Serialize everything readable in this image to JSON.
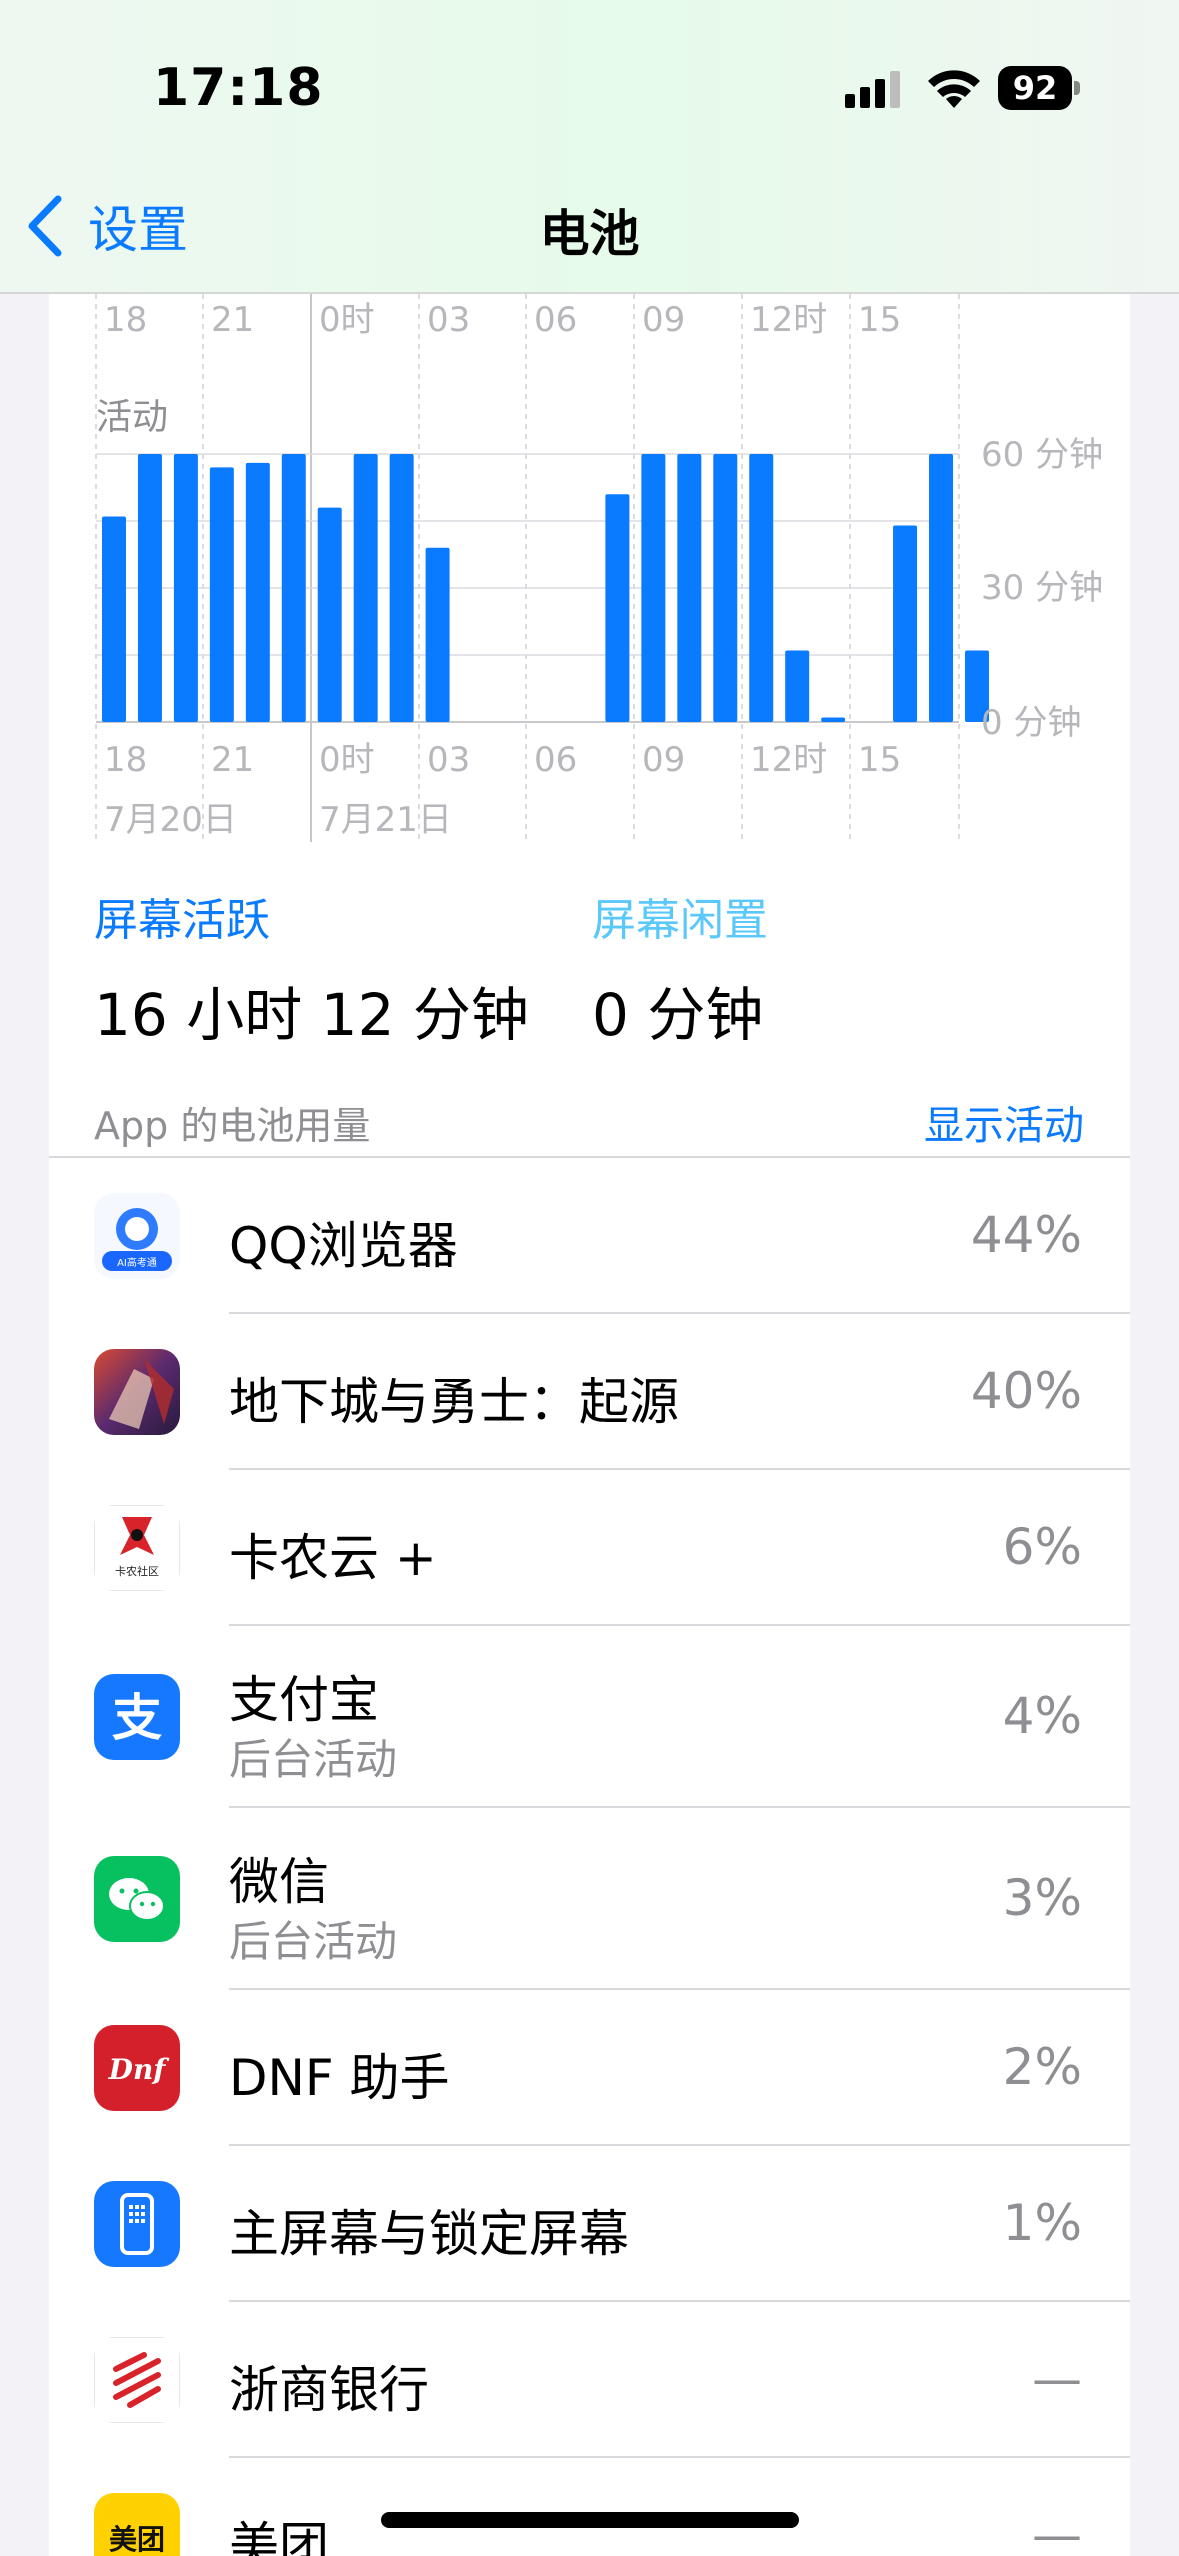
{
  "status": {
    "time": "17:18",
    "battery": "92"
  },
  "nav": {
    "back": "设置",
    "title": "电池"
  },
  "top_axis": [
    "18",
    "21",
    "0时",
    "03",
    "06",
    "09",
    "12时",
    "15"
  ],
  "chart": {
    "title": "活动"
  },
  "chart_data": {
    "type": "bar",
    "title": "活动",
    "categories": [
      "16",
      "17",
      "18",
      "19",
      "20",
      "21",
      "22",
      "23",
      "0时",
      "1",
      "2",
      "3",
      "4",
      "5",
      "6",
      "7",
      "8",
      "9",
      "10",
      "11",
      "12时",
      "13",
      "14",
      "15",
      "16",
      "17"
    ],
    "x_tick_labels": [
      "18",
      "21",
      "0时",
      "03",
      "06",
      "09",
      "12时",
      "15"
    ],
    "x_date_labels": [
      "7月20日",
      "7月21日"
    ],
    "values": [
      46,
      60,
      60,
      57,
      58,
      60,
      48,
      60,
      60,
      39,
      0,
      0,
      0,
      0,
      51,
      60,
      60,
      60,
      60,
      16,
      1,
      0,
      44,
      60,
      16
    ],
    "y_ticks": [
      "60 分钟",
      "30 分钟",
      "0 分钟"
    ],
    "ylim": [
      0,
      60
    ],
    "grid": true,
    "color": "#0a7aff"
  },
  "summary": {
    "active_label": "屏幕活跃",
    "active_value": "16 小时 12 分钟",
    "idle_label": "屏幕闲置",
    "idle_value": "0 分钟"
  },
  "section": {
    "title": "App 的电池用量",
    "action": "显示活动"
  },
  "apps": [
    {
      "name": "QQ浏览器",
      "pct": "44%",
      "icon": "qq-browser-icon"
    },
    {
      "name": "地下城与勇士：起源",
      "pct": "40%",
      "icon": "dnf-game-icon"
    },
    {
      "name": "卡农云 +",
      "pct": "6%",
      "icon": "kanong-icon",
      "icon_text": "卡农社区"
    },
    {
      "name": "支付宝",
      "sub": "后台活动",
      "pct": "4%",
      "icon": "alipay-icon",
      "icon_text": "支"
    },
    {
      "name": "微信",
      "sub": "后台活动",
      "pct": "3%",
      "icon": "wechat-icon"
    },
    {
      "name": "DNF 助手",
      "pct": "2%",
      "icon": "dnf-helper-icon",
      "icon_text": "Dnf"
    },
    {
      "name": "主屏幕与锁定屏幕",
      "pct": "1%",
      "icon": "home-screen-icon"
    },
    {
      "name": "浙商银行",
      "pct": "—",
      "icon": "czbank-icon"
    },
    {
      "name": "美团",
      "pct": "—",
      "icon": "meituan-icon",
      "icon_text": "美团"
    }
  ],
  "qq_icon_text": "AI高考通"
}
